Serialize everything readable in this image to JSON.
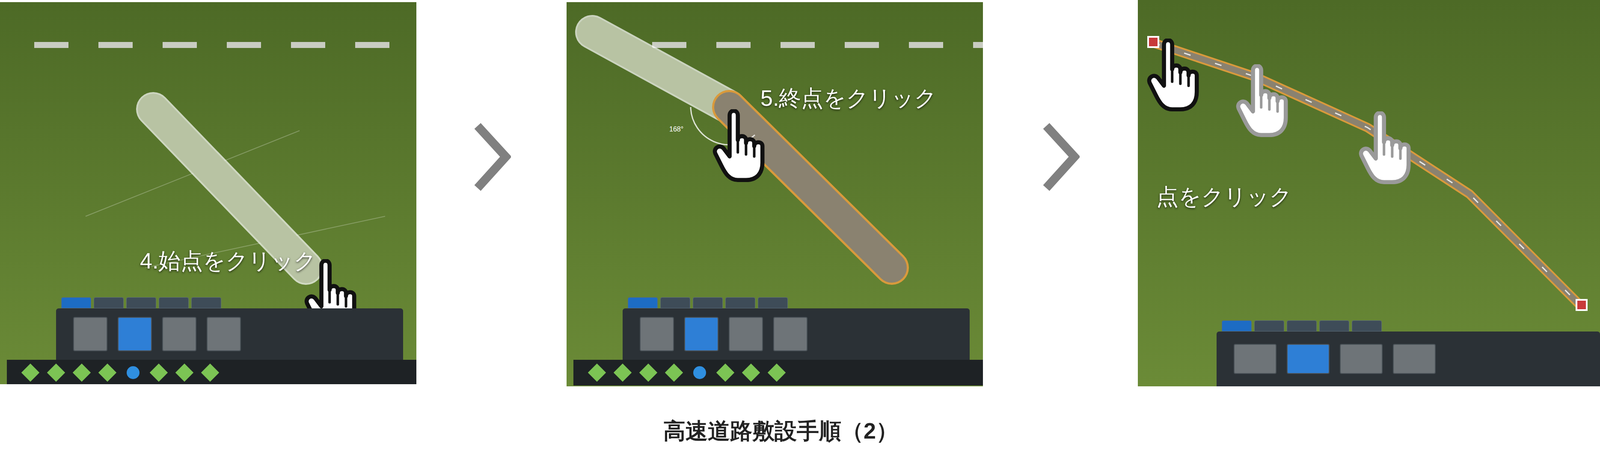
{
  "caption": "高速道路敷設手順（2）",
  "steps": [
    {
      "kind": "start",
      "label": "4.始点をクリック",
      "tabs": [
        {
          "selected": true
        },
        {
          "selected": false
        },
        {
          "selected": false
        },
        {
          "selected": false
        },
        {
          "selected": false
        }
      ]
    },
    {
      "kind": "end",
      "label": "5.終点をクリック",
      "angle": "168°",
      "tabs": [
        {
          "selected": true
        },
        {
          "selected": false
        },
        {
          "selected": false
        },
        {
          "selected": false
        },
        {
          "selected": false
        }
      ]
    },
    {
      "kind": "points",
      "label": "点をクリック",
      "hands": [
        {
          "active": true
        },
        {
          "active": false
        },
        {
          "active": false
        }
      ],
      "tabs": [
        {
          "selected": true
        },
        {
          "selected": false
        },
        {
          "selected": false
        },
        {
          "selected": false
        },
        {
          "selected": false
        }
      ]
    }
  ]
}
